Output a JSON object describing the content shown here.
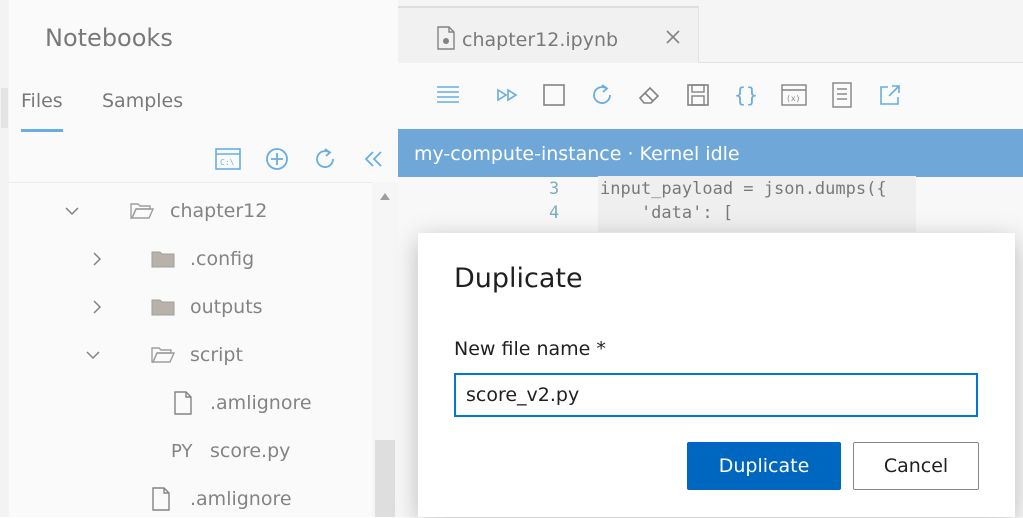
{
  "sidebar": {
    "title": "Notebooks",
    "tabs": [
      {
        "label": "Files",
        "active": true
      },
      {
        "label": "Samples",
        "active": false
      }
    ],
    "tools": [
      "terminal-icon",
      "add-icon",
      "refresh-icon",
      "collapse-icon"
    ],
    "tree": [
      {
        "label": "chapter12",
        "type": "folder-open",
        "expanded": true
      },
      {
        "label": ".config",
        "type": "folder",
        "expanded": false
      },
      {
        "label": "outputs",
        "type": "folder",
        "expanded": false
      },
      {
        "label": "script",
        "type": "folder-open",
        "expanded": true
      },
      {
        "label": ".amlignore",
        "type": "file"
      },
      {
        "label": "score.py",
        "type": "python",
        "icon_text": "PY"
      },
      {
        "label": ".amlignore",
        "type": "file"
      }
    ]
  },
  "editor": {
    "tab_label": "chapter12.ipynb",
    "kernel_status": "my-compute-instance · Kernel idle",
    "code_lines": [
      {
        "num": "3",
        "text": "input_payload = json.dumps({"
      },
      {
        "num": "4",
        "text": "    'data': ["
      }
    ]
  },
  "modal": {
    "title": "Duplicate",
    "field_label": "New file name *",
    "field_value": "score_v2.py",
    "primary_button": "Duplicate",
    "secondary_button": "Cancel"
  },
  "colors": {
    "accent": "#0078d4",
    "kernel_bar": "#106ebe",
    "primary_button": "#0067c0"
  }
}
